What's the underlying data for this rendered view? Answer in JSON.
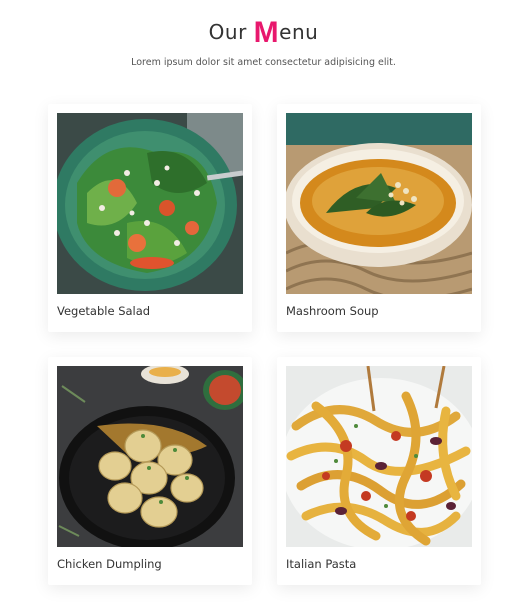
{
  "header": {
    "title_prefix": "Our ",
    "title_accent": "M",
    "title_suffix": "enu",
    "subtitle": "Lorem ipsum dolor sit amet consectetur adipisicing elit."
  },
  "menu": {
    "items": [
      {
        "name": "Vegetable Salad"
      },
      {
        "name": "Mashroom Soup"
      },
      {
        "name": "Chicken Dumpling"
      },
      {
        "name": "Italian Pasta"
      }
    ]
  },
  "colors": {
    "accent": "#e8186d",
    "background": "#ffffff"
  }
}
